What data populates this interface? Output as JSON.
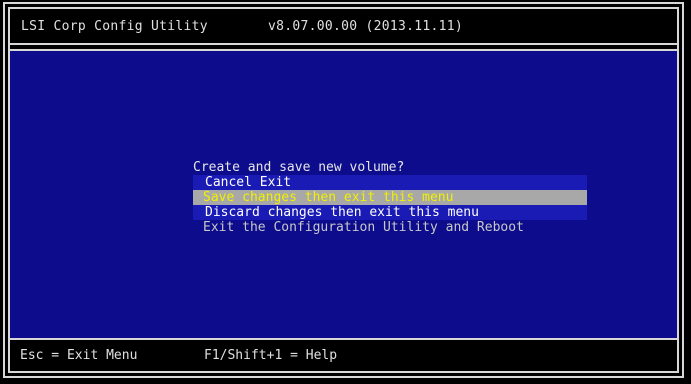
{
  "header": {
    "app_title": "LSI Corp Config Utility",
    "version": "v8.07.00.00 (2013.11.11)"
  },
  "dialog": {
    "prompt": "Create and save new volume?",
    "options": [
      {
        "label": "Cancel Exit",
        "state": "normal"
      },
      {
        "label": "Save changes then exit this menu",
        "state": "selected"
      },
      {
        "label": "Discard changes then exit this menu",
        "state": "normal"
      },
      {
        "label": "Exit the Configuration Utility and Reboot",
        "state": "normal"
      }
    ]
  },
  "footer": {
    "esc_hint": "Esc = Exit Menu",
    "help_hint": "F1/Shift+1 = Help"
  },
  "colors": {
    "background_blue": "#0c0c8c",
    "menu_blue": "#1a1ab4",
    "selected_bg": "#a8a8a8",
    "selected_text": "#f0f000",
    "frame": "#d8d8d8"
  }
}
